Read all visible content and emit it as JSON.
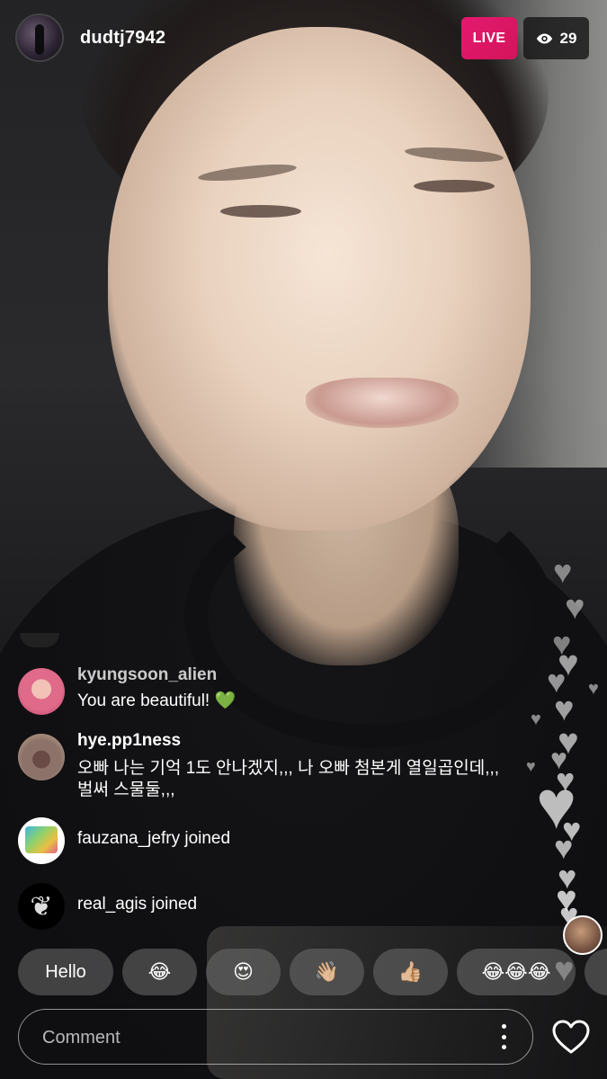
{
  "host": {
    "username": "dudtj7942"
  },
  "live_label": "LIVE",
  "viewer_count": "29",
  "comments": [
    {
      "user": "kyungsoon_alien",
      "text": "You are beautiful! 💚"
    },
    {
      "user": "hye.pp1ness",
      "text": "오빠 나는 기억 1도 안나겠지,,, 나 오빠 첨본게 열일곱인데,,,",
      "text2": "벌써 스물둘,,,"
    }
  ],
  "joins": [
    {
      "user": "fauzana_jefry",
      "text": "fauzana_jefry joined"
    },
    {
      "user": "real_agis",
      "text": "real_agis joined"
    }
  ],
  "quick_replies": [
    "Hello",
    "😂",
    "😍",
    "👋🏼",
    "👍🏼",
    "😂😂😂"
  ],
  "comment_input": {
    "placeholder": "Comment"
  },
  "icons": {
    "viewers": "eye-icon",
    "more": "more-vertical-icon",
    "like": "heart-outline-icon",
    "floating": "heart-icon"
  }
}
